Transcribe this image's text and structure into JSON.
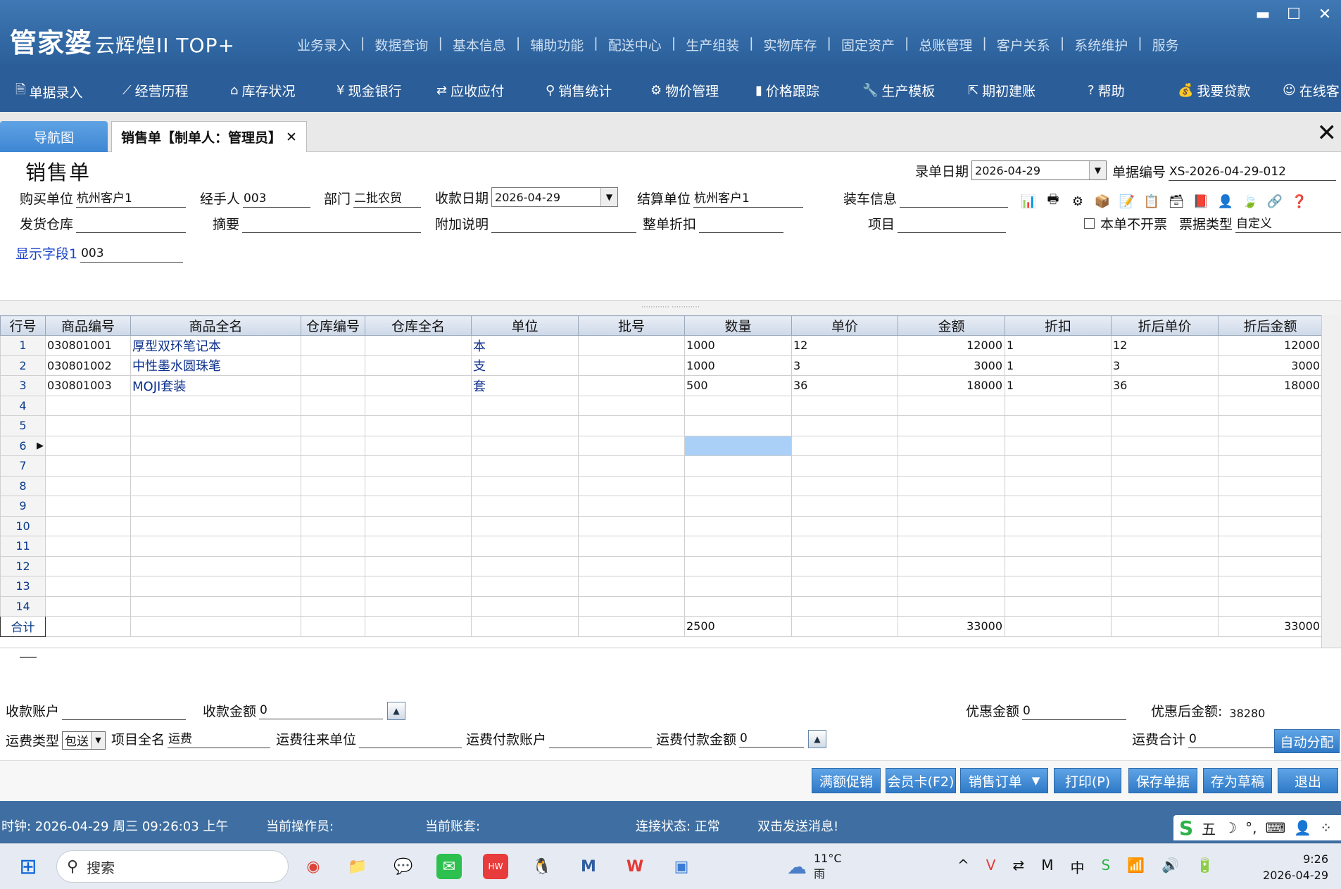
{
  "app": {
    "logo_main": "管家婆",
    "logo_sub": "云辉煌II TOP+",
    "menu": [
      "业务录入",
      "数据查询",
      "基本信息",
      "辅助功能",
      "配送中心",
      "生产组装",
      "实物库存",
      "固定资产",
      "总账管理",
      "客户关系",
      "系统维护",
      "服务"
    ],
    "window_controls": {
      "minimize": "▬",
      "maximize": "☐",
      "close": "✕"
    }
  },
  "toolbar": [
    {
      "icon": "receipt-icon",
      "glyph": "🗎",
      "label": "单据录入"
    },
    {
      "icon": "chart-line-icon",
      "glyph": "⟋",
      "label": "经营历程"
    },
    {
      "icon": "home-icon",
      "glyph": "⌂",
      "label": "库存状况"
    },
    {
      "icon": "yen-icon",
      "glyph": "¥",
      "label": "现金银行"
    },
    {
      "icon": "exchange-icon",
      "glyph": "⇄",
      "label": "应收应付"
    },
    {
      "icon": "search-icon",
      "glyph": "⚲",
      "label": "销售统计"
    },
    {
      "icon": "gear-icon",
      "glyph": "⚙",
      "label": "物价管理"
    },
    {
      "icon": "bar-chart-icon",
      "glyph": "▮",
      "label": "价格跟踪"
    },
    {
      "icon": "wrench-icon",
      "glyph": "🔧",
      "label": "生产模板"
    },
    {
      "icon": "external-link-icon",
      "glyph": "⇱",
      "label": "期初建账"
    },
    {
      "icon": "help-icon",
      "glyph": "?",
      "label": "帮助"
    },
    {
      "icon": "money-bag-icon",
      "glyph": "💰",
      "label": "我要贷款"
    },
    {
      "icon": "chat-icon",
      "glyph": "☺",
      "label": "在线客"
    }
  ],
  "tabs": {
    "nav": "导航图",
    "active": "销售单【制单人：管理员】",
    "close": "✕"
  },
  "form": {
    "title": "销售单",
    "entry_date_label": "录单日期",
    "entry_date": "2026-04-29",
    "doc_no_label": "单据编号",
    "doc_no": "XS-2026-04-29-012",
    "buyer_label": "购买单位",
    "buyer": "杭州客户1",
    "handler_label": "经手人",
    "handler": "003",
    "dept_label": "部门",
    "dept": "二批农贸",
    "collect_date_label": "收款日期",
    "collect_date": "2026-04-29",
    "settle_label": "结算单位",
    "settle": "杭州客户1",
    "loading_label": "装车信息",
    "warehouse_label": "发货仓库",
    "summary_label": "摘要",
    "extra_label": "附加说明",
    "discount_label": "整单折扣",
    "project_label": "项目",
    "no_invoice_label": "本单不开票",
    "invoice_type_label": "票据类型",
    "invoice_type": "自定义",
    "display_field_label": "显示字段1",
    "display_field": "003"
  },
  "grid": {
    "headers": [
      "行号",
      "商品编号",
      "商品全名",
      "仓库编号",
      "仓库全名",
      "单位",
      "批号",
      "数量",
      "单价",
      "金额",
      "折扣",
      "折后单价",
      "折后金额"
    ],
    "rows": [
      {
        "no": "1",
        "code": "030801001",
        "name": "厚型双环笔记本",
        "wh_code": "",
        "wh_name": "",
        "unit": "本",
        "batch": "",
        "qty": "1000",
        "price": "12",
        "amount": "12000",
        "disc": "1",
        "disc_price": "12",
        "disc_amount": "12000"
      },
      {
        "no": "2",
        "code": "030801002",
        "name": "中性墨水圆珠笔",
        "wh_code": "",
        "wh_name": "",
        "unit": "支",
        "batch": "",
        "qty": "1000",
        "price": "3",
        "amount": "3000",
        "disc": "1",
        "disc_price": "3",
        "disc_amount": "3000"
      },
      {
        "no": "3",
        "code": "030801003",
        "name": "MOJI套装",
        "wh_code": "",
        "wh_name": "",
        "unit": "套",
        "batch": "",
        "qty": "500",
        "price": "36",
        "amount": "18000",
        "disc": "1",
        "disc_price": "36",
        "disc_amount": "18000"
      }
    ],
    "empty_rows": [
      "4",
      "5",
      "6",
      "7",
      "8",
      "9",
      "10",
      "11",
      "12",
      "13",
      "14"
    ],
    "total_label": "合计",
    "total_qty": "2500",
    "total_amount": "33000",
    "total_disc_amount": "33000"
  },
  "bottom": {
    "account_label": "收款账户",
    "collect_amount_label": "收款金额",
    "collect_amount": "0",
    "discount_amount_label": "优惠金额",
    "discount_amount": "0",
    "after_discount_label": "优惠后金额:",
    "after_discount": "38280",
    "freight_type_label": "运费类型",
    "freight_type": "包送",
    "project_name_label": "项目全名",
    "project_name": "运费",
    "freight_unit_label": "运费往来单位",
    "freight_account_label": "运费付款账户",
    "freight_pay_label": "运费付款金额",
    "freight_pay": "0",
    "freight_total_label": "运费合计",
    "freight_total": "0",
    "auto_alloc": "自动分配"
  },
  "actions": [
    "满额促销",
    "会员卡(F2)",
    "销售订单",
    "打印(P)",
    "保存单据",
    "存为草稿",
    "退出"
  ],
  "status": {
    "clock": "时钟: 2026-04-29 周三 09:26:03 上午",
    "operator": "当前操作员:",
    "account_set": "当前账套:",
    "connection": "连接状态: 正常",
    "message": "双击发送消息!",
    "ime": [
      "S",
      "五",
      "☽",
      "°,",
      "⌨",
      "👤",
      "⁘"
    ]
  },
  "taskbar": {
    "search": "搜索",
    "weather_temp": "11°C",
    "weather_desc": "雨",
    "time": "9:26",
    "date": "2026-04-29"
  }
}
